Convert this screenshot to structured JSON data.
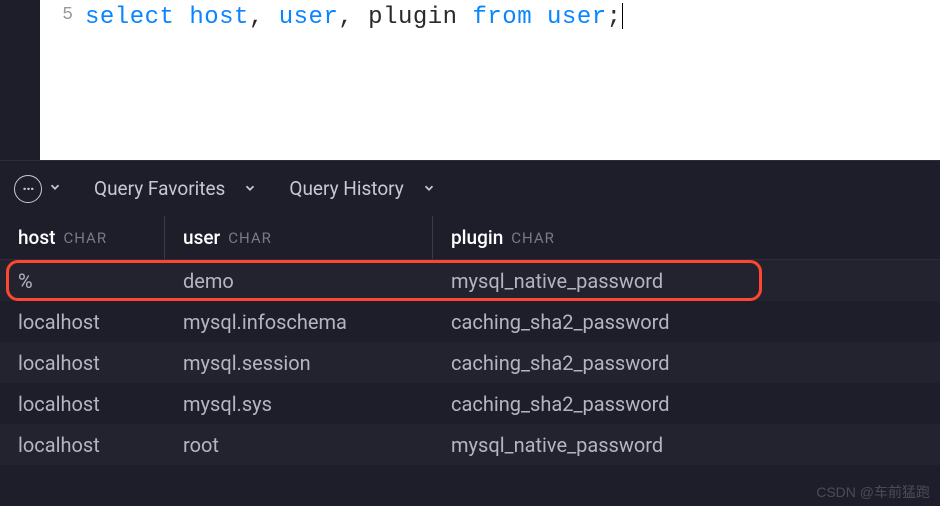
{
  "editor": {
    "line_number": "5",
    "tokens": {
      "select": "select",
      "host": "host",
      "comma1": ", ",
      "user1": "user",
      "comma2": ", ",
      "plugin": "plugin ",
      "from": "from",
      "sp": " ",
      "user2": "user",
      "semi": ";"
    }
  },
  "toolbar": {
    "more_label": "···",
    "query_favorites": "Query Favorites",
    "query_history": "Query History"
  },
  "table": {
    "columns": [
      {
        "name": "host",
        "type": "CHAR"
      },
      {
        "name": "user",
        "type": "CHAR"
      },
      {
        "name": "plugin",
        "type": "CHAR"
      }
    ],
    "rows": [
      {
        "host": "%",
        "user": "demo",
        "plugin": "mysql_native_password"
      },
      {
        "host": "localhost",
        "user": "mysql.infoschema",
        "plugin": "caching_sha2_password"
      },
      {
        "host": "localhost",
        "user": "mysql.session",
        "plugin": "caching_sha2_password"
      },
      {
        "host": "localhost",
        "user": "mysql.sys",
        "plugin": "caching_sha2_password"
      },
      {
        "host": "localhost",
        "user": "root",
        "plugin": "mysql_native_password"
      }
    ]
  },
  "watermark": "CSDN @车前猛跑"
}
